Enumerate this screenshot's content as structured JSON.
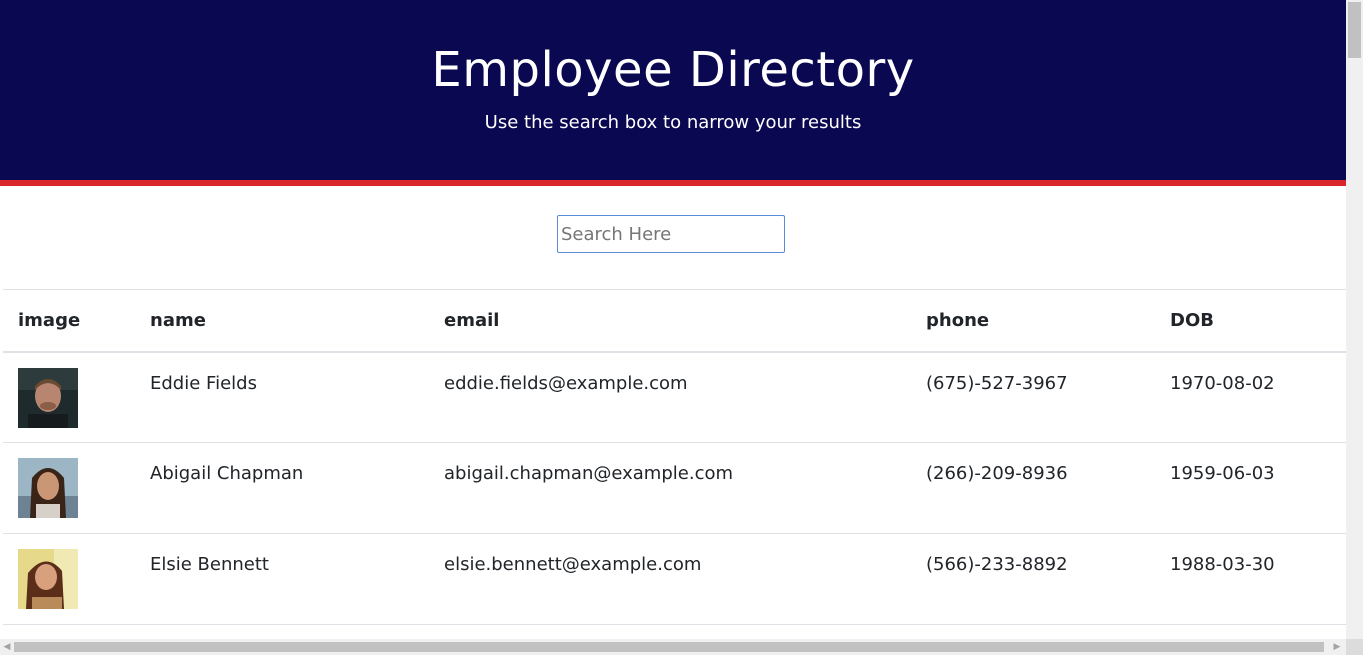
{
  "header": {
    "title": "Employee Directory",
    "subtitle": "Use the search box to narrow your results"
  },
  "search": {
    "placeholder": "Search Here",
    "value": ""
  },
  "table": {
    "columns": [
      "image",
      "name",
      "email",
      "phone",
      "DOB"
    ],
    "rows": [
      {
        "name": "Eddie Fields",
        "email": "eddie.fields@example.com",
        "phone": "(675)-527-3967",
        "dob": "1970-08-02"
      },
      {
        "name": "Abigail Chapman",
        "email": "abigail.chapman@example.com",
        "phone": "(266)-209-8936",
        "dob": "1959-06-03"
      },
      {
        "name": "Elsie Bennett",
        "email": "elsie.bennett@example.com",
        "phone": "(566)-233-8892",
        "dob": "1988-03-30"
      }
    ]
  },
  "colors": {
    "header_bg": "#0a0851",
    "header_border": "#d9262b",
    "search_border": "#5b8bd6"
  }
}
